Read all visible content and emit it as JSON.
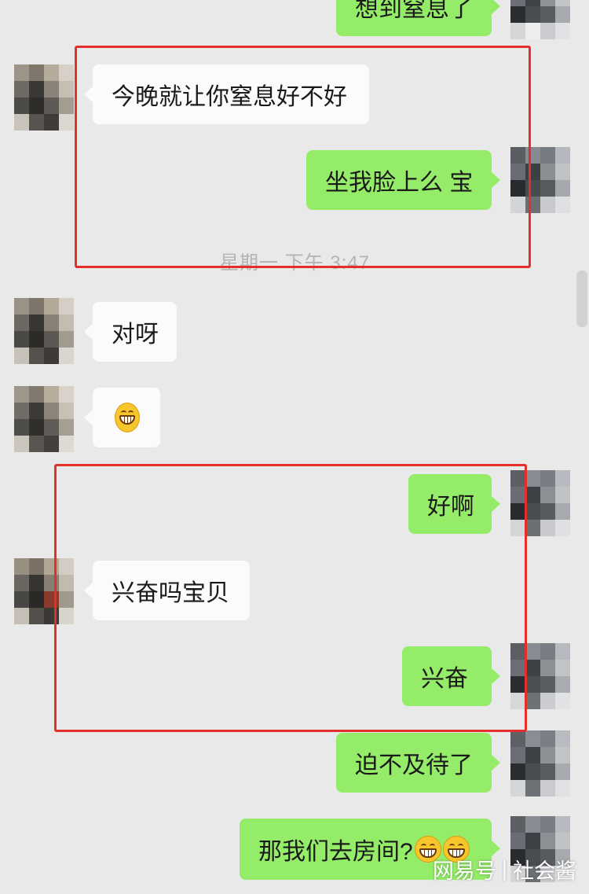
{
  "chat": {
    "timestamp": "星期一 下午 3:47",
    "messages": [
      {
        "side": "right",
        "text": "想到窒息了"
      },
      {
        "side": "left",
        "text": "今晚就让你窒息好不好"
      },
      {
        "side": "right",
        "text": "坐我脸上么 宝"
      },
      {
        "side": "left",
        "text": "对呀"
      },
      {
        "side": "left",
        "emoji": "grinning-face-emoji"
      },
      {
        "side": "right",
        "text": "好啊"
      },
      {
        "side": "left",
        "text": "兴奋吗宝贝"
      },
      {
        "side": "right",
        "text": "兴奋"
      },
      {
        "side": "right",
        "text": "迫不及待了"
      },
      {
        "side": "right",
        "text": "那我们去房间?",
        "emoji": [
          "grinning-face-emoji",
          "grinning-face-emoji"
        ]
      }
    ]
  },
  "watermark": {
    "brand": "网易号",
    "separator": "|",
    "account": "社会酱"
  },
  "colors": {
    "background": "#e9e9e9",
    "bubble_right": "#95ec69",
    "bubble_left": "#fbfbfb",
    "highlight_box": "#e4302b"
  }
}
